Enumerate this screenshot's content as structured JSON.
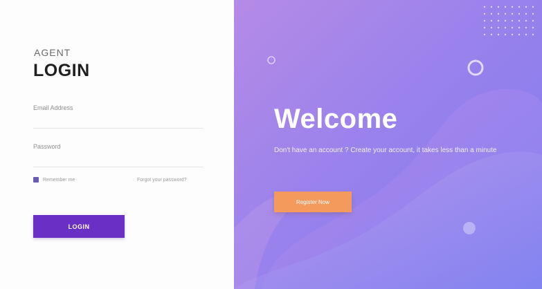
{
  "login_panel": {
    "eyebrow": "AGENT",
    "title": "LOGIN",
    "email_label": "Email Address",
    "email_value": "",
    "password_label": "Password",
    "password_value": "",
    "remember_label": "Remember me",
    "forgot_label": "Forgot your password?",
    "login_button": "LOGIN"
  },
  "welcome_panel": {
    "heading": "Welcome",
    "subtitle": "Don't have an account ? Create your account, it takes less than a minute",
    "register_button": "Register Now"
  },
  "colors": {
    "accent_purple": "#6a2fc4",
    "panel_gradient_start": "#b58be6",
    "panel_gradient_end": "#7f7bee",
    "register_orange": "#f39a5c"
  }
}
